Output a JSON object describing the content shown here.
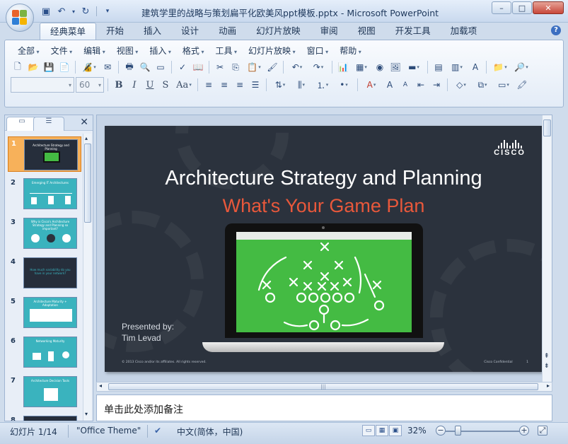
{
  "window": {
    "title": "建筑学里的战略与策划扁平化欧美风ppt模板.pptx - Microsoft PowerPoint",
    "controls": {
      "minimize": "–",
      "maximize": "□",
      "close": "✕"
    }
  },
  "ribbon": {
    "tabs": [
      {
        "label": "经典菜单",
        "active": true
      },
      {
        "label": "开始"
      },
      {
        "label": "插入"
      },
      {
        "label": "设计"
      },
      {
        "label": "动画"
      },
      {
        "label": "幻灯片放映"
      },
      {
        "label": "审阅"
      },
      {
        "label": "视图"
      },
      {
        "label": "开发工具"
      },
      {
        "label": "加载项"
      }
    ],
    "menus": [
      "全部",
      "文件",
      "编辑",
      "视图",
      "插入",
      "格式",
      "工具",
      "幻灯片放映",
      "窗口",
      "帮助"
    ],
    "font_name": "",
    "font_size": "60",
    "format_buttons": {
      "bold": "B",
      "italic": "I",
      "underline": "U",
      "strike": "S",
      "case": "Aa"
    }
  },
  "pane": {
    "close": "✕",
    "slides": [
      {
        "num": "1",
        "title": "Architecture Strategy and Planning",
        "selected": true
      },
      {
        "num": "2",
        "title": "Emerging IT Architectures"
      },
      {
        "num": "3",
        "title": "Why is Cisco's Architecture Strategy and Planning so important?"
      },
      {
        "num": "4",
        "title": "How much variability do you have in your network?"
      },
      {
        "num": "5",
        "title": "Architecture Maturity + Adaptation"
      },
      {
        "num": "6",
        "title": "Networking Maturity"
      },
      {
        "num": "7",
        "title": "Architecture Decision Tools"
      },
      {
        "num": "8",
        "title": ""
      }
    ]
  },
  "slide": {
    "title": "Architecture Strategy and Planning",
    "subtitle": "What's Your Game Plan",
    "presented_by": "Presented by:",
    "presenter": "Tim Levad",
    "logo_text": "CISCO",
    "footer_left": "© 2013 Cisco and/or its affiliates. All rights reserved.",
    "footer_center": "Cisco Confidential",
    "page": "1"
  },
  "notes": {
    "placeholder": "单击此处添加备注"
  },
  "status": {
    "slide_counter": "幻灯片 1/14",
    "theme": "\"Office Theme\"",
    "language": "中文(简体，中国)",
    "zoom": "32%",
    "zoom_level": 0.32
  },
  "colors": {
    "slide_bg": "#2b323d",
    "title": "#ffffff",
    "subtitle": "#e8583b",
    "play_field": "#44bb43",
    "selected_thumb": "#f7b15a"
  }
}
